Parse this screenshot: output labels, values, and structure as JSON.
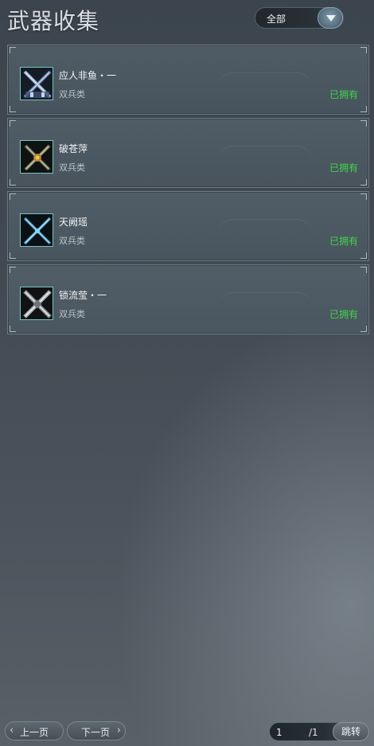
{
  "header": {
    "title": "武器收集",
    "filter": {
      "selected": "全部"
    }
  },
  "weapons": [
    {
      "name": "应人非鱼・一",
      "type": "双兵类",
      "status": "已拥有",
      "icon": "dual-blades-blue-icon"
    },
    {
      "name": "破苍萍",
      "type": "双兵类",
      "status": "已拥有",
      "icon": "dual-blades-gold-icon"
    },
    {
      "name": "天阙瑶",
      "type": "双兵类",
      "status": "已拥有",
      "icon": "dual-blades-cyan-icon"
    },
    {
      "name": "锁流莹・一",
      "type": "双兵类",
      "status": "已拥有",
      "icon": "dual-blades-silver-icon"
    }
  ],
  "footer": {
    "prev_label": "上一页",
    "next_label": "下一页",
    "page_current": "1",
    "page_total": "/1",
    "jump_label": "跳转"
  },
  "colors": {
    "owned": "#3fd44a",
    "icon_border": "#79c3c0"
  }
}
